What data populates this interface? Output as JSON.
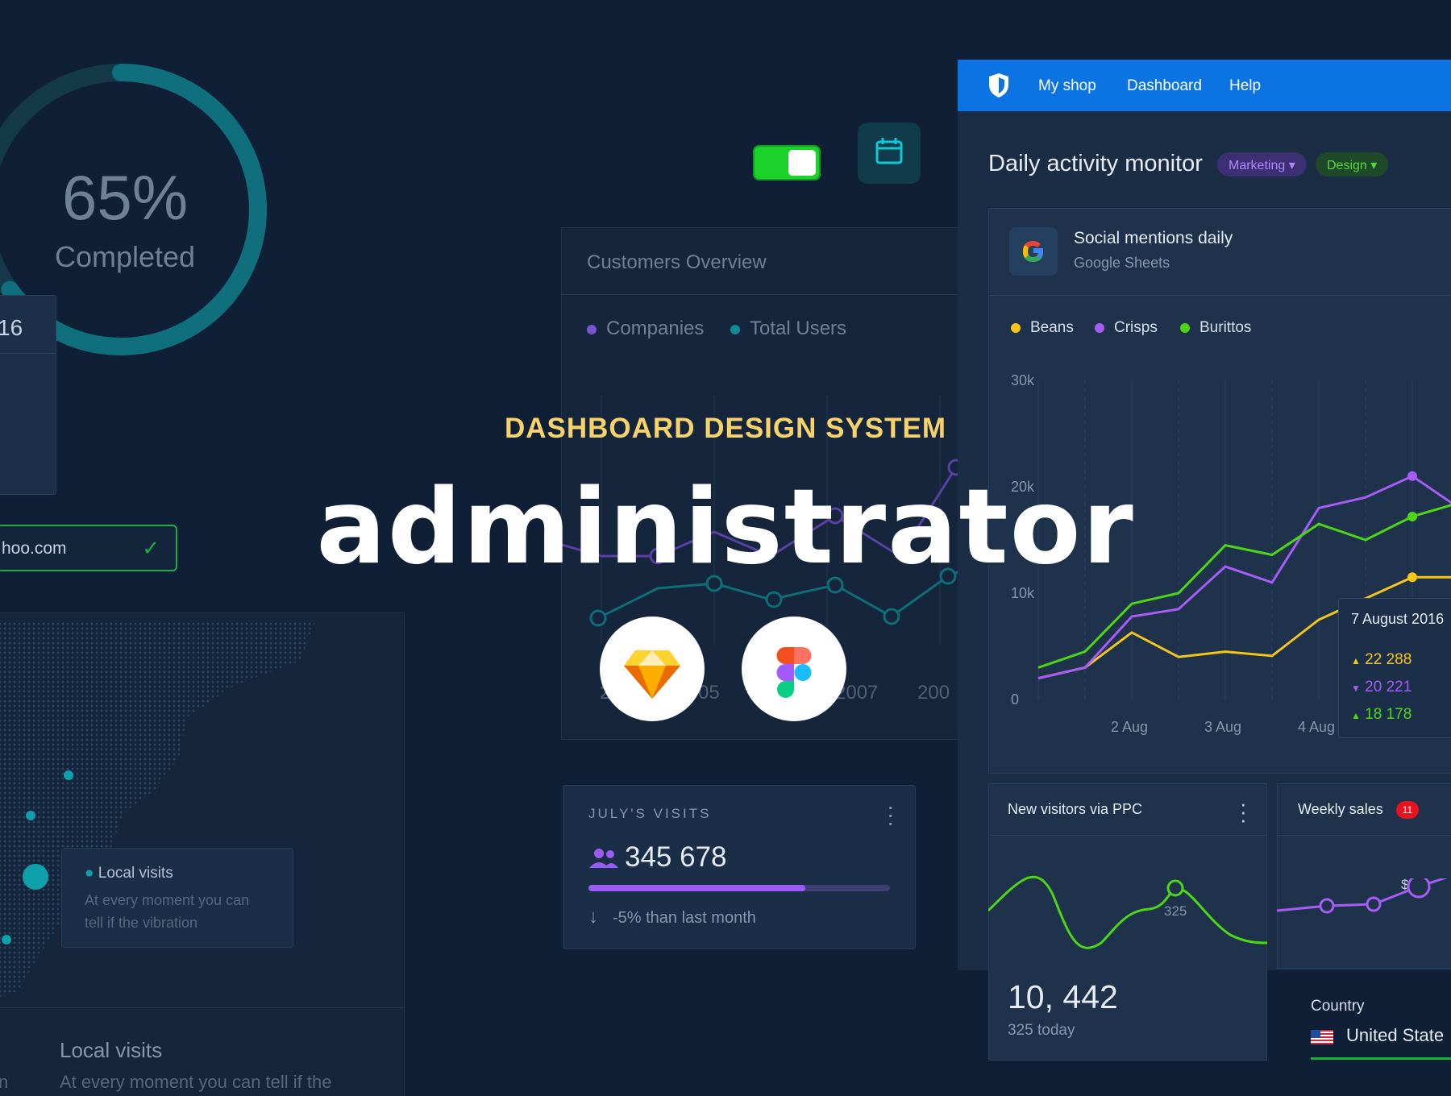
{
  "progress": {
    "percent_label": "65%",
    "label": "Completed",
    "value": 0.65
  },
  "left_card": {
    "value": "16"
  },
  "email_field": {
    "value": "hoo.com"
  },
  "map": {
    "tooltip_title": "Local visits",
    "tooltip_desc_1": "At every moment you can",
    "tooltip_desc_2": "tell if the vibration",
    "section_title": "Local visits",
    "section_desc": "At every moment you can tell if the",
    "left_fragment": "n"
  },
  "customers": {
    "title": "Customers Overview",
    "legend": [
      {
        "label": "Companies",
        "color": "#7b55d1"
      },
      {
        "label": "Total Users",
        "color": "#0e8a95"
      }
    ],
    "years": [
      "2",
      "05",
      "2007",
      "200"
    ]
  },
  "hero": {
    "subtitle": "DASHBOARD DESIGN SYSTEM",
    "title": "administrator"
  },
  "july_visits": {
    "label": "JULY'S VISITS",
    "value": "345 678",
    "progress": 0.72,
    "change": "-5% than last month"
  },
  "nav": {
    "links": [
      "My shop",
      "Dashboard",
      "Help"
    ]
  },
  "dam": {
    "title": "Daily activity monitor",
    "tags": [
      {
        "label": "Marketing",
        "color": "#b087ff"
      },
      {
        "label": "Design",
        "color": "#55d63a"
      }
    ]
  },
  "social": {
    "title": "Social mentions daily",
    "source": "Google Sheets"
  },
  "chart_data": {
    "type": "line",
    "title": "Social mentions daily",
    "x": [
      "1 Aug",
      "1.5 Aug",
      "2 Aug",
      "2.5 Aug",
      "3 Aug",
      "3.5 Aug",
      "4 Aug",
      "4.5 Aug",
      "5 Aug",
      "5.5 Aug"
    ],
    "x_tick_labels": [
      "2 Aug",
      "3 Aug",
      "4 Aug"
    ],
    "y_tick_labels": [
      "30k",
      "20k",
      "10k",
      "0"
    ],
    "ylim": [
      0,
      30000
    ],
    "legend_position": "top-left",
    "series": [
      {
        "name": "Beans",
        "color": "#f5c518",
        "values": [
          2000,
          3000,
          6300,
          4000,
          4500,
          4100,
          7500,
          9500,
          11500,
          11500
        ]
      },
      {
        "name": "Crisps",
        "color": "#a65cf5",
        "values": [
          2000,
          3000,
          7800,
          8500,
          12500,
          11000,
          18000,
          19000,
          21000,
          18000
        ]
      },
      {
        "name": "Burittos",
        "color": "#4cd616",
        "values": [
          3000,
          4500,
          9000,
          10000,
          14500,
          13600,
          16500,
          15000,
          17200,
          18500
        ]
      }
    ],
    "tooltip": {
      "date": "7 August 2016",
      "rows": [
        {
          "value": "22 288",
          "direction": "up",
          "color": "#f5c518"
        },
        {
          "value": "20 221",
          "direction": "down",
          "color": "#a65cf5"
        },
        {
          "value": "18 178",
          "direction": "up",
          "color": "#4cd616"
        }
      ]
    }
  },
  "ppc": {
    "title": "New visitors via PPC",
    "point_label": "325",
    "value": "10, 442",
    "sub": "325 today"
  },
  "weekly_sales": {
    "title": "Weekly sales",
    "badge": "11",
    "point_label": "$22k"
  },
  "country": {
    "label": "Country",
    "value": "United State"
  }
}
